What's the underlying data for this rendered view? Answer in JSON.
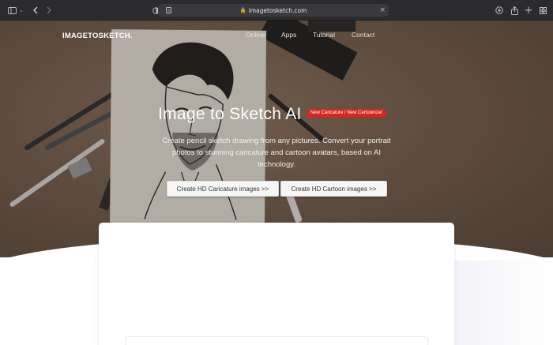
{
  "browser": {
    "url": "imagetosketch.com",
    "icons": [
      "sidebar-icon",
      "chevron-down-icon",
      "back-icon",
      "forward-icon",
      "shield-icon",
      "page-icon",
      "lock-icon",
      "close-icon",
      "download-icon",
      "share-icon",
      "new-tab-icon",
      "tab-overview-icon"
    ]
  },
  "header": {
    "brand": "IMAGETOSKETCH.",
    "nav": [
      "Online",
      "Apps",
      "Tutorial",
      "Contact"
    ]
  },
  "hero": {
    "title": "Image to Sketch AI",
    "badge": "New Caricature / New Cartoonizer",
    "subtitle": "Create pencil sketch drawing from any pictures. Convert your portrait photos to stunning caricature and cartoon avatars, based on AI technology.",
    "buttons": [
      "Create HD Caricature images >>",
      "Create HD Cartoon images >>"
    ]
  },
  "colors": {
    "badge": "#e0231c",
    "chrome": "#2b2b2d",
    "hero_bg": "#6f5b4b"
  }
}
